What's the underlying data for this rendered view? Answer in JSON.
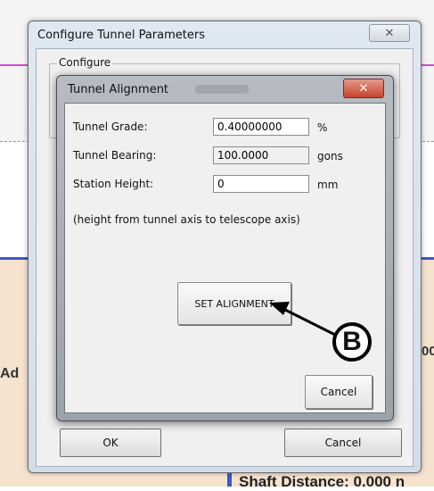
{
  "background": {
    "left_partial_text": "Ad",
    "right_partial_text": "00",
    "bottom_partial_text": "Shaft Distance:   0.000 n",
    "colors": {
      "magenta_line": "#d24bd2",
      "blue_line": "#3f56c8",
      "band": "#f6e3cf"
    }
  },
  "outer_dialog": {
    "title": "Configure Tunnel Parameters",
    "close_glyph": "✕",
    "group_label": "Configure",
    "ok_label": "OK",
    "cancel_label": "Cancel"
  },
  "inner_dialog": {
    "title": "Tunnel Alignment",
    "close_glyph": "✕",
    "fields": [
      {
        "label": "Tunnel Grade:",
        "value": "0.40000000",
        "unit": "%"
      },
      {
        "label": "Tunnel Bearing:",
        "value": "100.0000",
        "unit": "gons"
      },
      {
        "label": "Station Height:",
        "value": "0",
        "unit": "mm"
      }
    ],
    "note": "(height from tunnel axis to telescope axis)",
    "set_alignment_label": "SET ALIGNMENT",
    "cancel_label": "Cancel"
  },
  "callout": {
    "letter": "B"
  }
}
